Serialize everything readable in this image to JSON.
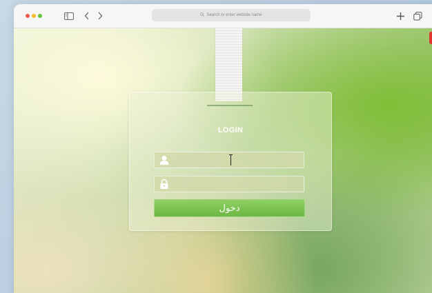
{
  "browser": {
    "address_placeholder": "Search or enter website name",
    "icons": {
      "sidebar": "sidebar-icon",
      "back": "chevron-left-icon",
      "forward": "chevron-right-icon",
      "search": "search-icon",
      "new_tab": "plus-icon",
      "tabs": "tabs-overview-icon"
    }
  },
  "page": {
    "close_label": "✕",
    "login_title": "LOGIN",
    "username_value": "",
    "password_value": "",
    "login_button_label": "دخول",
    "icons": {
      "username": "user-icon",
      "password": "lock-icon"
    }
  },
  "colors": {
    "close_red": "#e0382f",
    "button_green": "#6cb844",
    "traffic_red": "#ee5a52",
    "traffic_yellow": "#f5bd2e",
    "traffic_green": "#5fc63c"
  }
}
